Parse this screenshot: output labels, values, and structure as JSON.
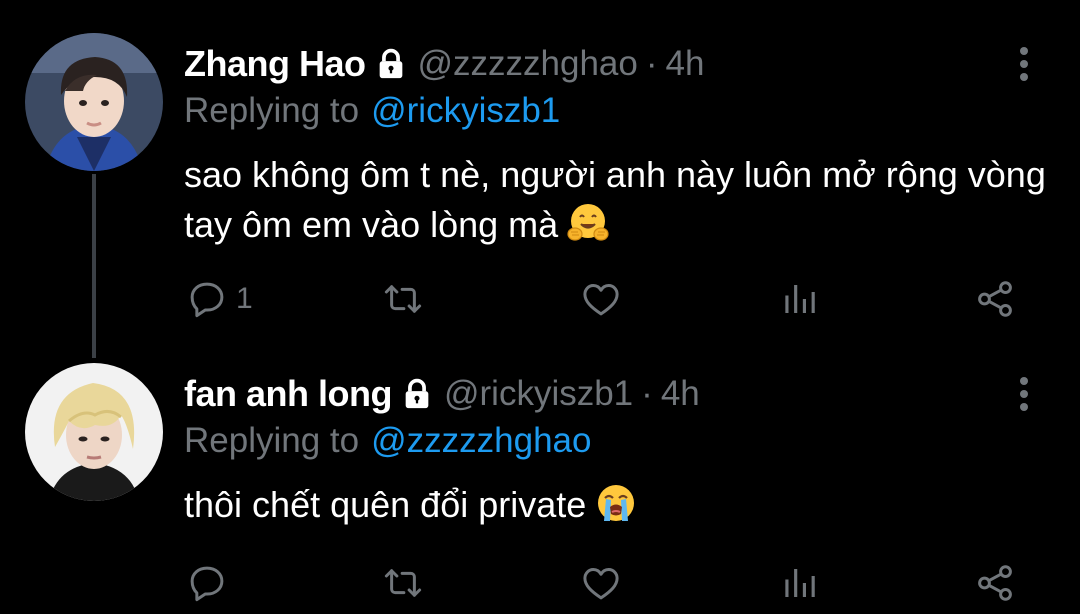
{
  "tweets": [
    {
      "display_name": "Zhang Hao",
      "handle": "@zzzzzhghao",
      "separator": "·",
      "time": "4h",
      "replying_prefix": "Replying to",
      "replying_to": "@rickyiszb1",
      "text": "sao không ôm t nè, người anh này luôn mở rộng vòng tay ôm em vào lòng mà",
      "emoji": "hugging-face-emoji",
      "reply_count": "1",
      "protected": true
    },
    {
      "display_name": "fan anh long",
      "handle": "@rickyiszb1",
      "separator": "·",
      "time": "4h",
      "replying_prefix": "Replying to",
      "replying_to": "@zzzzzhghao",
      "text": "thôi chết quên đổi private",
      "emoji": "loudly-crying-face-emoji",
      "reply_count": "",
      "protected": true
    }
  ],
  "colors": {
    "background": "#000000",
    "text_primary": "#ffffff",
    "text_secondary": "#71767b",
    "link": "#1d9bf0",
    "thread_line": "#3b4046"
  },
  "icons": [
    "lock-icon",
    "more-icon",
    "reply-icon",
    "retweet-icon",
    "like-icon",
    "stats-icon",
    "share-icon"
  ]
}
